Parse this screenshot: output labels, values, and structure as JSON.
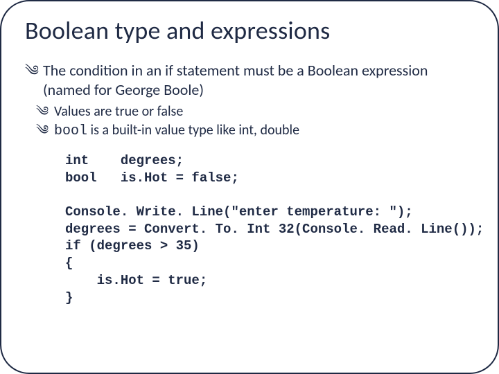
{
  "title": "Boolean type and expressions",
  "bullets": {
    "b1": "The condition in an if statement must be a Boolean expression (named for George Boole)",
    "b2": "Values are true or false",
    "b3_code": "bool",
    "b3_rest": " is a built-in value type like int, double"
  },
  "glyph": "༄",
  "code": "int    degrees;\nbool   is.Hot = false;\n\nConsole. Write. Line(\"enter temperature: \");\ndegrees = Convert. To. Int 32(Console. Read. Line());\nif (degrees > 35)\n{\n    is.Hot = true;\n}"
}
